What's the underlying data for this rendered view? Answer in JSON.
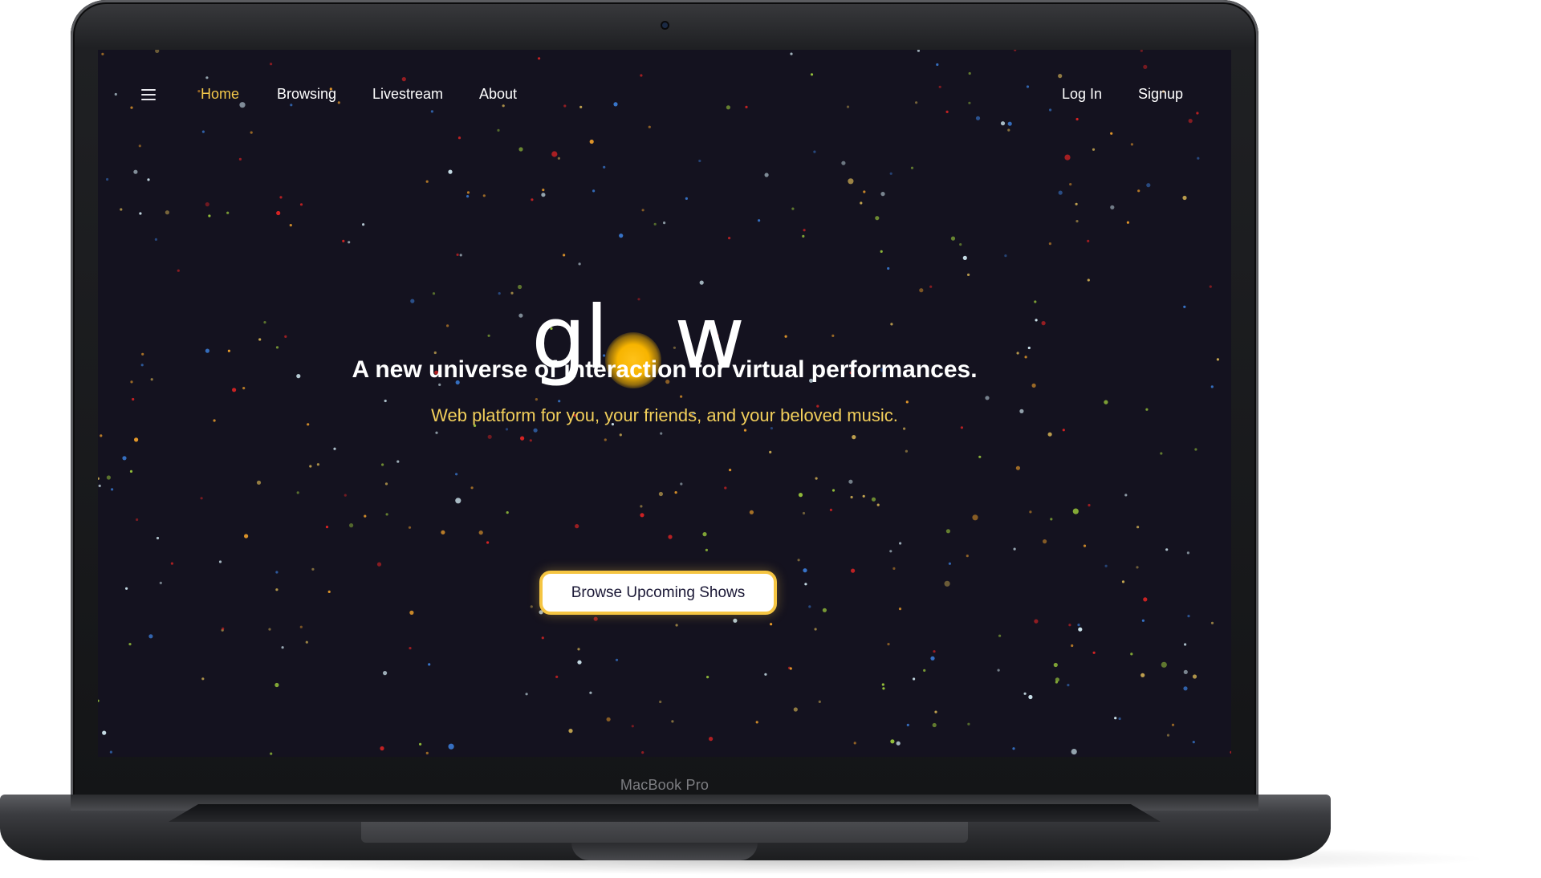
{
  "device": {
    "model_label": "MacBook Pro"
  },
  "nav": {
    "menu_icon": "hamburger-menu-icon",
    "links": [
      {
        "label": "Home",
        "active": true
      },
      {
        "label": "Browsing",
        "active": false
      },
      {
        "label": "Livestream",
        "active": false
      },
      {
        "label": "About",
        "active": false
      }
    ],
    "login_label": "Log In",
    "signup_label": "Signup"
  },
  "hero": {
    "logo_left": "gl",
    "logo_right": "w",
    "logo_o_icon": "glowing-sun-icon",
    "headline": "A  new universe of interaction for virtual performances.",
    "subheadline": "Web platform for you, your friends, and your beloved music.",
    "cta_label": "Browse Upcoming Shows"
  },
  "colors": {
    "background": "#14121f",
    "accent": "#f4c84a",
    "star_palette": [
      "#f2a12b",
      "#9ccb3c",
      "#e02424",
      "#3a7bd5",
      "#d6eef7",
      "#cfae53"
    ]
  }
}
